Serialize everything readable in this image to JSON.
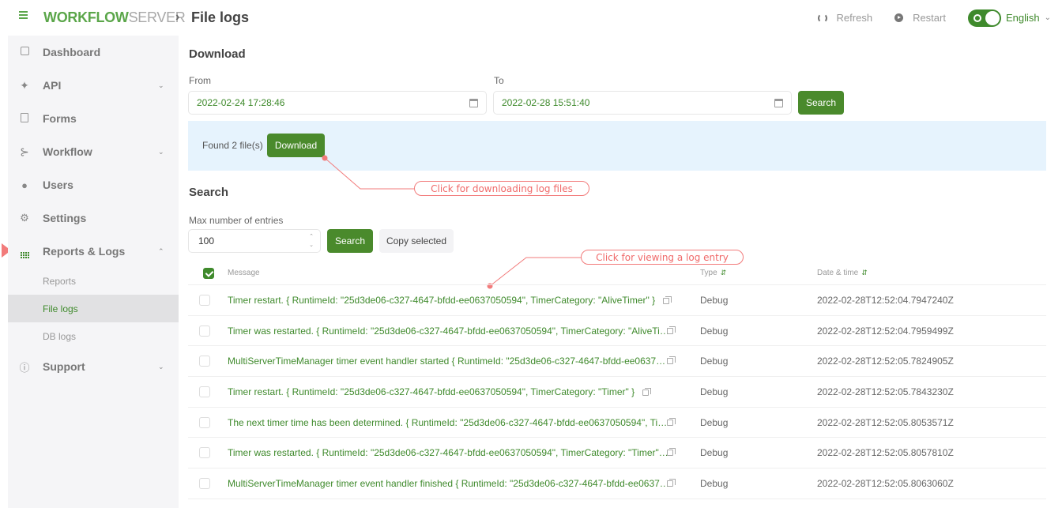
{
  "header": {
    "brand_primary": "WORKFLOW",
    "brand_secondary": "SERVER",
    "breadcrumb_separator": "›",
    "title": "File logs",
    "actions": {
      "refresh_label": "Refresh",
      "restart_label": "Restart",
      "language": "English"
    }
  },
  "sidebar": {
    "items": [
      {
        "label": "Dashboard",
        "icon": "dashboard-icon"
      },
      {
        "label": "API",
        "icon": "plug-icon",
        "expandable": true
      },
      {
        "label": "Forms",
        "icon": "form-icon"
      },
      {
        "label": "Workflow",
        "icon": "workflow-icon",
        "expandable": true
      },
      {
        "label": "Users",
        "icon": "users-icon"
      },
      {
        "label": "Settings",
        "icon": "gears-icon"
      },
      {
        "label": "Reports & Logs",
        "icon": "report-grid-icon",
        "expandable": true,
        "expanded": true
      },
      {
        "label": "Support",
        "icon": "help-icon",
        "expandable": true
      }
    ],
    "sub_items": [
      {
        "label": "Reports"
      },
      {
        "label": "File logs",
        "active": true
      },
      {
        "label": "DB logs"
      }
    ]
  },
  "download": {
    "heading": "Download",
    "from_label": "From",
    "from_value": "2022-02-24 17:28:46",
    "to_label": "To",
    "to_value": "2022-02-28 15:51:40",
    "search_label": "Search",
    "found_text": "Found 2 file(s)",
    "download_label": "Download"
  },
  "search": {
    "heading": "Search",
    "max_label": "Max number of entries",
    "max_value": "100",
    "search_label": "Search",
    "copy_label": "Copy selected"
  },
  "callouts": {
    "download": "Click for downloading log files",
    "view": "Click for viewing a log entry"
  },
  "table": {
    "columns": [
      "Message",
      "Type",
      "Date & time"
    ],
    "rows": [
      {
        "message": "Timer restart. { RuntimeId: \"25d3de06-c327-4647-bfdd-ee0637050594\", TimerCategory: \"AliveTimer\" }",
        "type": "Debug",
        "datetime": "2022-02-28T12:52:04.7947240Z"
      },
      {
        "message": "Timer was restarted. { RuntimeId: \"25d3de06-c327-4647-bfdd-ee0637050594\", TimerCategory: \"AliveTi…",
        "type": "Debug",
        "datetime": "2022-02-28T12:52:04.7959499Z"
      },
      {
        "message": "MultiServerTimeManager timer event handler started { RuntimeId: \"25d3de06-c327-4647-bfdd-ee0637…",
        "type": "Debug",
        "datetime": "2022-02-28T12:52:05.7824905Z"
      },
      {
        "message": "Timer restart. { RuntimeId: \"25d3de06-c327-4647-bfdd-ee0637050594\", TimerCategory: \"Timer\" }",
        "type": "Debug",
        "datetime": "2022-02-28T12:52:05.7843230Z"
      },
      {
        "message": "The next timer time has been determined. { RuntimeId: \"25d3de06-c327-4647-bfdd-ee0637050594\", Ti…",
        "type": "Debug",
        "datetime": "2022-02-28T12:52:05.8053571Z"
      },
      {
        "message": "Timer was restarted. { RuntimeId: \"25d3de06-c327-4647-bfdd-ee0637050594\", TimerCategory: \"Timer\"…",
        "type": "Debug",
        "datetime": "2022-02-28T12:52:05.8057810Z"
      },
      {
        "message": "MultiServerTimeManager timer event handler finished { RuntimeId: \"25d3de06-c327-4647-bfdd-ee0637…",
        "type": "Debug",
        "datetime": "2022-02-28T12:52:05.8063060Z"
      }
    ]
  },
  "colors": {
    "accent": "#3f8a2c",
    "brand_green": "#5ba64a",
    "callout": "#f27b7b",
    "info_bg": "#e6f3fd",
    "sidebar_bg": "#f5f5f7"
  }
}
